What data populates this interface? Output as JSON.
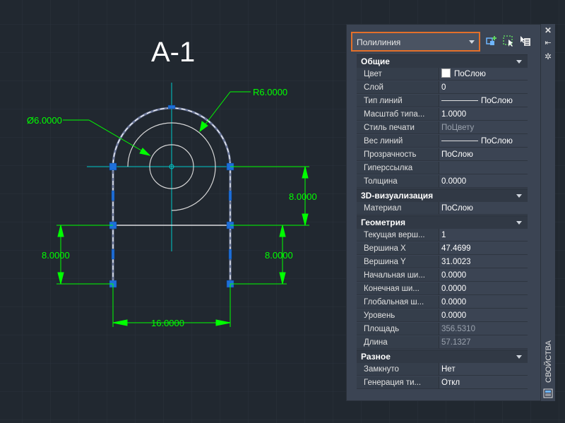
{
  "drawing": {
    "title": "A-1",
    "dims": {
      "dia": "Ø6.0000",
      "radius": "R6.0000",
      "right_height": "8.0000",
      "left_height": "8.0000",
      "inner_height": "8.0000",
      "width": "16.0000"
    }
  },
  "palette": {
    "selector_value": "Полилиния",
    "vertical_title": "СВОЙСТВА",
    "categories": [
      {
        "name": "Общие",
        "rows": [
          {
            "k": "Цвет",
            "v": "ПоСлою",
            "kind": "color"
          },
          {
            "k": "Слой",
            "v": "0"
          },
          {
            "k": "Тип линий",
            "v": "ПоСлою",
            "kind": "ltype"
          },
          {
            "k": "Масштаб типа...",
            "v": "1.0000"
          },
          {
            "k": "Стиль печати",
            "v": "ПоЦвету",
            "kind": "muted"
          },
          {
            "k": "Вес линий",
            "v": "ПоСлою",
            "kind": "ltype"
          },
          {
            "k": "Прозрачность",
            "v": "ПоСлою"
          },
          {
            "k": "Гиперссылка",
            "v": ""
          },
          {
            "k": "Толщина",
            "v": "0.0000"
          }
        ]
      },
      {
        "name": "3D-визуализация",
        "rows": [
          {
            "k": "Материал",
            "v": "ПоСлою"
          }
        ]
      },
      {
        "name": "Геометрия",
        "rows": [
          {
            "k": "Текущая верш...",
            "v": "1"
          },
          {
            "k": "Вершина X",
            "v": "47.4699"
          },
          {
            "k": "Вершина Y",
            "v": "31.0023"
          },
          {
            "k": "Начальная ши...",
            "v": "0.0000"
          },
          {
            "k": "Конечная ши...",
            "v": "0.0000"
          },
          {
            "k": "Глобальная ш...",
            "v": "0.0000"
          },
          {
            "k": "Уровень",
            "v": "0.0000"
          },
          {
            "k": "Площадь",
            "v": "356.5310",
            "kind": "muted"
          },
          {
            "k": "Длина",
            "v": "57.1327",
            "kind": "muted"
          }
        ]
      },
      {
        "name": "Разное",
        "rows": [
          {
            "k": "Замкнуто",
            "v": "Нет"
          },
          {
            "k": "Генерация ти...",
            "v": "Откл"
          }
        ]
      }
    ]
  },
  "colors": {
    "background": "#212830",
    "dimension": "#00ff00",
    "centerline": "#00c8c8",
    "selection_grip": "#1e6fd9",
    "highlight": "#e3702a"
  },
  "icons": [
    "quick-select-icon",
    "select-objects-icon",
    "toggle-pickadd-icon",
    "close-icon",
    "autohide-icon",
    "settings-icon",
    "palette-menu-icon"
  ]
}
